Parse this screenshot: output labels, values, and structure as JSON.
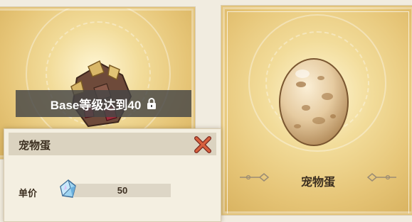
{
  "left_card": {
    "lock_text": "Base等级达到40",
    "icons": [
      "rock-gem-icon",
      "lock-icon"
    ]
  },
  "panel": {
    "title": "宠物蛋",
    "price_label": "单价",
    "price_value": "50",
    "icons": [
      "close-icon",
      "crystal-currency-icon"
    ]
  },
  "right_card": {
    "label": "宠物蛋",
    "icons": [
      "pet-egg-icon",
      "ornament-left-icon",
      "ornament-right-icon"
    ]
  },
  "colors": {
    "card_gold": "#e6c577",
    "banner": "#464646",
    "close_red": "#c0392b",
    "text_dark": "#3c2f20"
  }
}
